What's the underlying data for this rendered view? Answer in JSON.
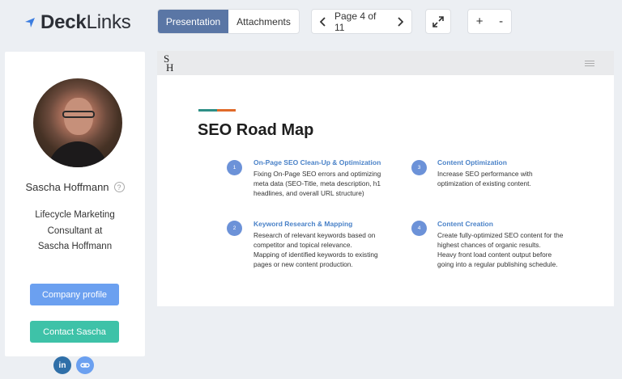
{
  "app": {
    "logo_primary": "Deck",
    "logo_secondary": "Links",
    "accent": "#3b7de0"
  },
  "toolbar": {
    "tabs": [
      {
        "label": "Presentation",
        "active": true
      },
      {
        "label": "Attachments",
        "active": false
      }
    ],
    "page_label": "Page 4 of 11",
    "zoom_in": "+",
    "zoom_out": "-"
  },
  "profile": {
    "name": "Sascha Hoffmann",
    "title_lines": [
      "Lifecycle Marketing",
      "Consultant at",
      "Sascha Hoffmann"
    ],
    "buttons": {
      "company": "Company profile",
      "contact": "Contact Sascha"
    },
    "socials": [
      "in",
      "link"
    ]
  },
  "slide": {
    "brand": {
      "top": "S",
      "bottom": "H"
    },
    "accent_colors": [
      "#2e8f86",
      "#e06a2a"
    ],
    "title": "SEO Road Map",
    "items": [
      {
        "number": "1",
        "heading": "On-Page SEO Clean-Up & Optimization",
        "body": [
          "Fixing On-Page SEO errors and optimizing",
          "meta data (SEO-Title, meta description, h1",
          "headlines, and overall URL structure)"
        ]
      },
      {
        "number": "3",
        "heading": "Content Optimization",
        "body": [
          "Increase SEO performance with",
          "optimization of existing content."
        ]
      },
      {
        "number": "2",
        "heading": "Keyword Research & Mapping",
        "body": [
          "Research of relevant keywords based on",
          "competitor and topical relevance.",
          "Mapping of identified keywords to existing",
          "pages or new content production."
        ]
      },
      {
        "number": "4",
        "heading": "Content Creation",
        "body": [
          "Create fully-optimized SEO content for the",
          "highest chances of organic results.",
          "Heavy front load content output before",
          "going into a regular publishing schedule."
        ]
      }
    ]
  }
}
